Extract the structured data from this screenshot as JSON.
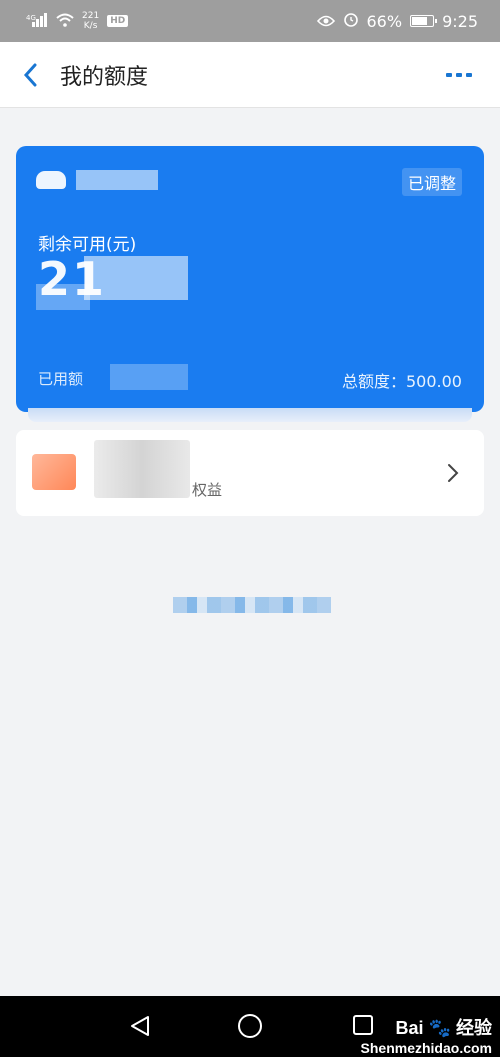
{
  "status_bar": {
    "signal_label": "4G",
    "net_speed_value": "221",
    "net_speed_unit": "K/s",
    "hd_badge": "HD",
    "battery_percent": "66%",
    "time": "9:25"
  },
  "nav": {
    "title": "我的额度"
  },
  "card": {
    "status": "已调整",
    "available_label": "剩余可用(元)",
    "available_amount": "21",
    "used_label": "已用额",
    "total_label": "总额度：500.00"
  },
  "benefit": {
    "label_fragment": "权益"
  },
  "watermark": {
    "brand": "Bai",
    "brand_suffix": "经验",
    "site": "Shenmezhidao.com"
  },
  "colors": {
    "card_blue": "#1a7cf0",
    "accent_blue": "#1976d2",
    "status_gray": "#9e9e9e",
    "page_bg": "#f2f3f5"
  }
}
